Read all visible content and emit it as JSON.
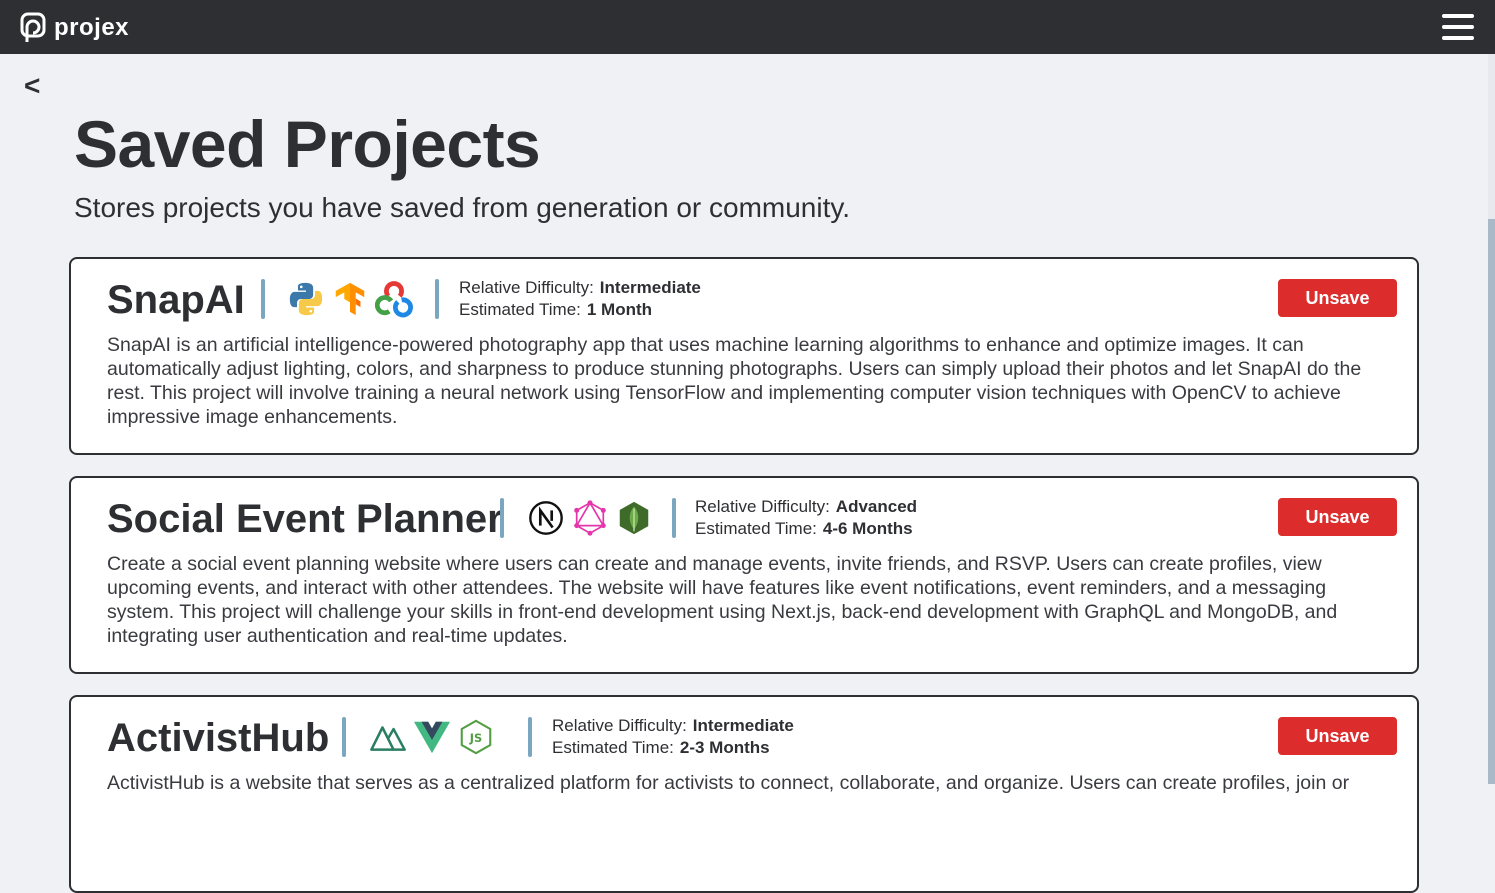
{
  "app": {
    "name": "projex"
  },
  "nav": {
    "back_label": "<"
  },
  "page": {
    "title": "Saved Projects",
    "subtitle": "Stores projects you have saved from generation or community."
  },
  "labels": {
    "difficulty": "Relative Difficulty:",
    "time": "Estimated Time:",
    "unsave": "Unsave"
  },
  "projects": [
    {
      "title": "SnapAI",
      "tech": [
        "python-icon",
        "tensorflow-icon",
        "opencv-icon"
      ],
      "difficulty": "Intermediate",
      "time": "1 Month",
      "description": "SnapAI is an artificial intelligence-powered photography app that uses machine learning algorithms to enhance and optimize images. It can automatically adjust lighting, colors, and sharpness to produce stunning photographs. Users can simply upload their photos and let SnapAI do the rest. This project will involve training a neural network using TensorFlow and implementing computer vision techniques with OpenCV to achieve impressive image enhancements."
    },
    {
      "title": "Social Event Planner",
      "tech": [
        "nextjs-icon",
        "graphql-icon",
        "mongodb-icon"
      ],
      "difficulty": "Advanced",
      "time": "4-6 Months",
      "description": "Create a social event planning website where users can create and manage events, invite friends, and RSVP. Users can create profiles, view upcoming events, and interact with other attendees. The website will have features like event notifications, event reminders, and a messaging system. This project will challenge your skills in front-end development using Next.js, back-end development with GraphQL and MongoDB, and integrating user authentication and real-time updates."
    },
    {
      "title": "ActivistHub",
      "tech": [
        "nuxt-icon",
        "vue-icon",
        "nodejs-icon"
      ],
      "difficulty": "Intermediate",
      "time": "2-3 Months",
      "description": "ActivistHub is a website that serves as a centralized platform for activists to connect, collaborate, and organize. Users can create profiles, join or"
    }
  ],
  "colors": {
    "topbar": "#2e2f33",
    "background": "#f0f1f5",
    "accent_separator": "#7aa6bf",
    "unsave_button": "#dd2c2c"
  }
}
